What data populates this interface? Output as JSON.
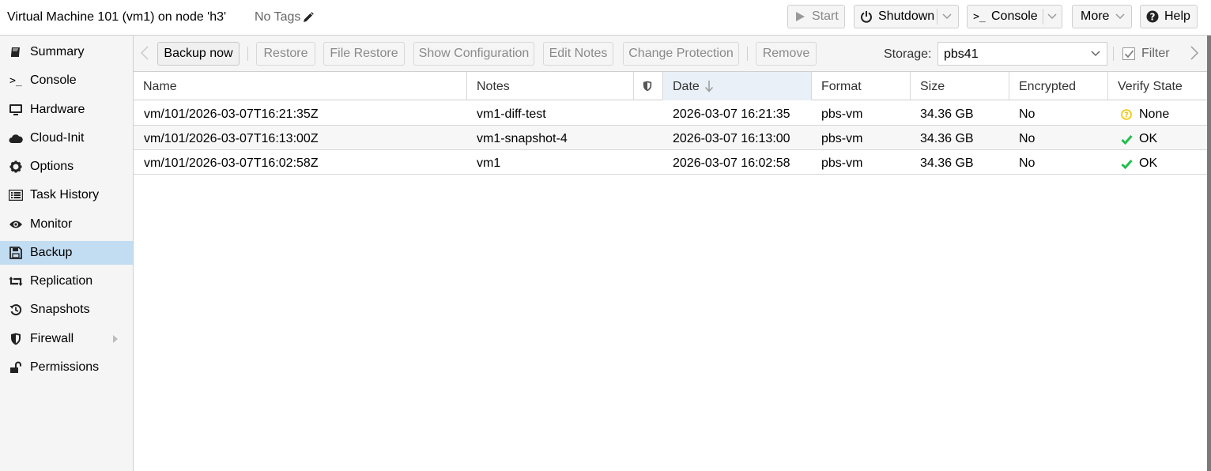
{
  "header": {
    "title": "Virtual Machine 101 (vm1) on node 'h3'",
    "tags": "No Tags",
    "buttons": {
      "start": "Start",
      "shutdown": "Shutdown",
      "console": "Console",
      "more": "More",
      "help": "Help"
    }
  },
  "sidebar": {
    "items": [
      {
        "label": "Summary",
        "icon": "book-icon"
      },
      {
        "label": "Console",
        "icon": "terminal-icon"
      },
      {
        "label": "Hardware",
        "icon": "desktop-icon"
      },
      {
        "label": "Cloud-Init",
        "icon": "cloud-icon"
      },
      {
        "label": "Options",
        "icon": "gear-icon"
      },
      {
        "label": "Task History",
        "icon": "list-icon"
      },
      {
        "label": "Monitor",
        "icon": "eye-icon"
      },
      {
        "label": "Backup",
        "icon": "floppy-icon"
      },
      {
        "label": "Replication",
        "icon": "retweet-icon"
      },
      {
        "label": "Snapshots",
        "icon": "history-icon"
      },
      {
        "label": "Firewall",
        "icon": "shield-icon"
      },
      {
        "label": "Permissions",
        "icon": "unlock-icon"
      }
    ],
    "active": "Backup"
  },
  "toolbar": {
    "backup_now": "Backup now",
    "restore": "Restore",
    "file_restore": "File Restore",
    "show_configuration": "Show Configuration",
    "edit_notes": "Edit Notes",
    "change_protection": "Change Protection",
    "remove": "Remove",
    "storage_label": "Storage:",
    "storage_value": "pbs41",
    "filter_label": "Filter"
  },
  "grid": {
    "columns": {
      "name": "Name",
      "notes": "Notes",
      "date": "Date",
      "format": "Format",
      "size": "Size",
      "encrypted": "Encrypted",
      "verify_state": "Verify State"
    },
    "sort": {
      "column": "Date",
      "direction": "desc"
    },
    "rows": [
      {
        "name": "vm/101/2026-03-07T16:21:35Z",
        "notes": "vm1-diff-test",
        "date": "2026-03-07 16:21:35",
        "format": "pbs-vm",
        "size": "34.36 GB",
        "encrypted": "No",
        "verify_state": "None",
        "verify_icon": "question-icon"
      },
      {
        "name": "vm/101/2026-03-07T16:13:00Z",
        "notes": "vm1-snapshot-4",
        "date": "2026-03-07 16:13:00",
        "format": "pbs-vm",
        "size": "34.36 GB",
        "encrypted": "No",
        "verify_state": "OK",
        "verify_icon": "check-icon"
      },
      {
        "name": "vm/101/2026-03-07T16:02:58Z",
        "notes": "vm1",
        "date": "2026-03-07 16:02:58",
        "format": "pbs-vm",
        "size": "34.36 GB",
        "encrypted": "No",
        "verify_state": "OK",
        "verify_icon": "check-icon"
      }
    ]
  },
  "colors": {
    "active_nav": "#c2ddf2",
    "ok_green": "#21bf4b",
    "unknown_yellow": "#f2c500"
  }
}
